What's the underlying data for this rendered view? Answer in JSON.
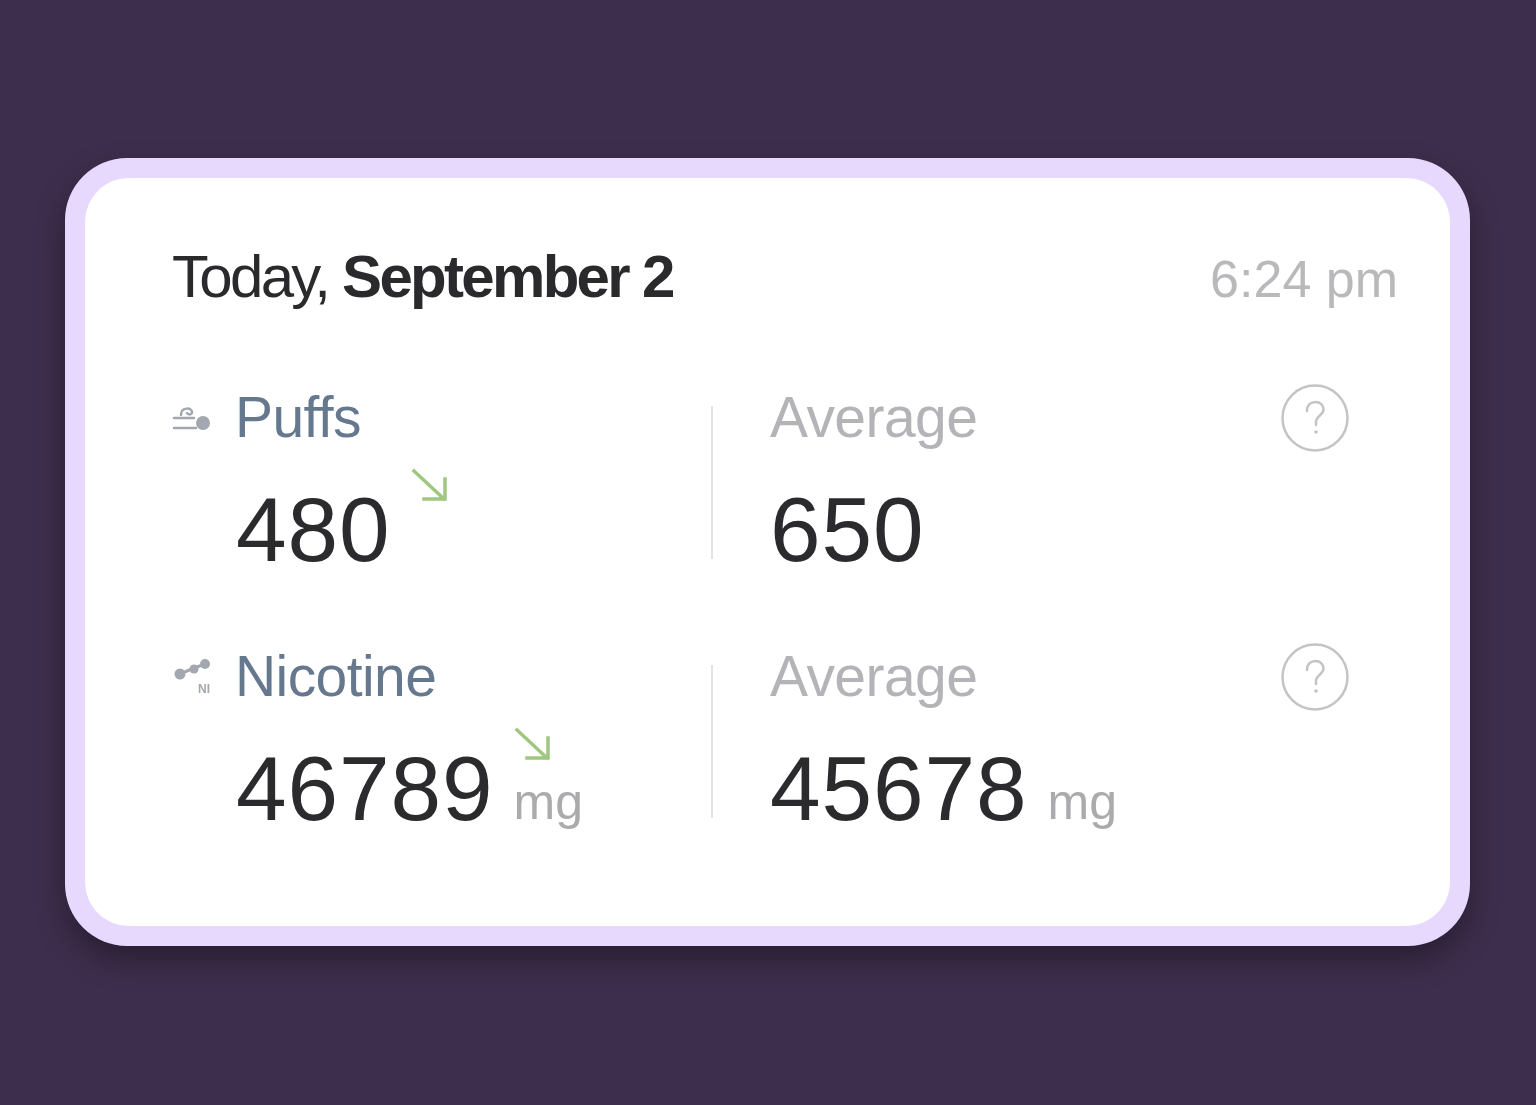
{
  "header": {
    "date": "Today, **September 2**",
    "time": "6:24 pm"
  },
  "metrics": [
    {
      "kind": "puffs",
      "label": "Puffs",
      "value": "480",
      "decreasing": true,
      "average_label": "Average",
      "average_value": "650"
    },
    {
      "kind": "nicotine",
      "label": "Nicotine",
      "icon_text": "NI",
      "value": "46789",
      "unit": "mg",
      "decreasing": true,
      "average_label": "Average",
      "average_value": "45678",
      "average_unit": "mg"
    }
  ]
}
